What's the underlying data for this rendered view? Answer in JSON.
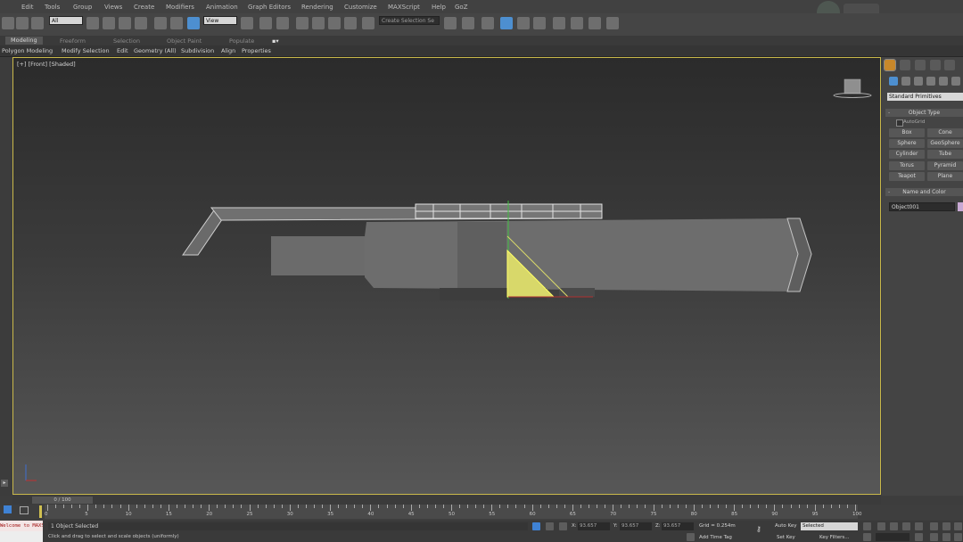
{
  "menu": [
    "Edit",
    "Tools",
    "Group",
    "Views",
    "Create",
    "Modifiers",
    "Animation",
    "Graph Editors",
    "Rendering",
    "Customize",
    "MAXScript",
    "Help",
    "GoZ"
  ],
  "toolbar": {
    "filter_select": "All",
    "ref_coord_select": "View",
    "named_selection": "Create Selection Se"
  },
  "ribbon": {
    "tabs": [
      "Modeling",
      "Freeform",
      "Selection",
      "Object Paint",
      "Populate"
    ],
    "active_tab": "Modeling",
    "groups": [
      "Polygon Modeling",
      "Modify Selection",
      "Edit",
      "Geometry (All)",
      "Subdivision",
      "Align",
      "Properties"
    ]
  },
  "viewport": {
    "label": "[+] [Front] [Shaded]",
    "selection_color": "#d8d86a",
    "border_color": "#c9b84a"
  },
  "command_panel": {
    "category": "Standard Primitives",
    "object_type_title": "Object Type",
    "autogrid": "AutoGrid",
    "buttons": [
      "Box",
      "Cone",
      "Sphere",
      "GeoSphere",
      "Cylinder",
      "Tube",
      "Torus",
      "Pyramid",
      "Teapot",
      "Plane"
    ],
    "name_color_title": "Name and Color",
    "object_name": "Object001",
    "object_color": "#c8a8d4"
  },
  "time_slider": {
    "label": "0 / 100"
  },
  "track_bar": {
    "ticks": [
      "0",
      "5",
      "10",
      "15",
      "20",
      "25",
      "30",
      "35",
      "40",
      "45",
      "50",
      "55",
      "60",
      "65",
      "70",
      "75",
      "80",
      "85",
      "90",
      "95",
      "100"
    ]
  },
  "status": {
    "selected": "1 Object Selected",
    "prompt": "Click and drag to select and scale objects (uniformly)",
    "listener": "Welcome to MAXS",
    "x_label": "X:",
    "x_value": "93.657",
    "y_label": "Y:",
    "y_value": "93.657",
    "z_label": "Z:",
    "z_value": "93.657",
    "grid": "Grid = 0.254m",
    "auto_key": "Auto Key",
    "set_key": "Set Key",
    "key_mode": "Selected",
    "key_filters": "Key Filters...",
    "add_time_tag": "Add Time Tag"
  }
}
